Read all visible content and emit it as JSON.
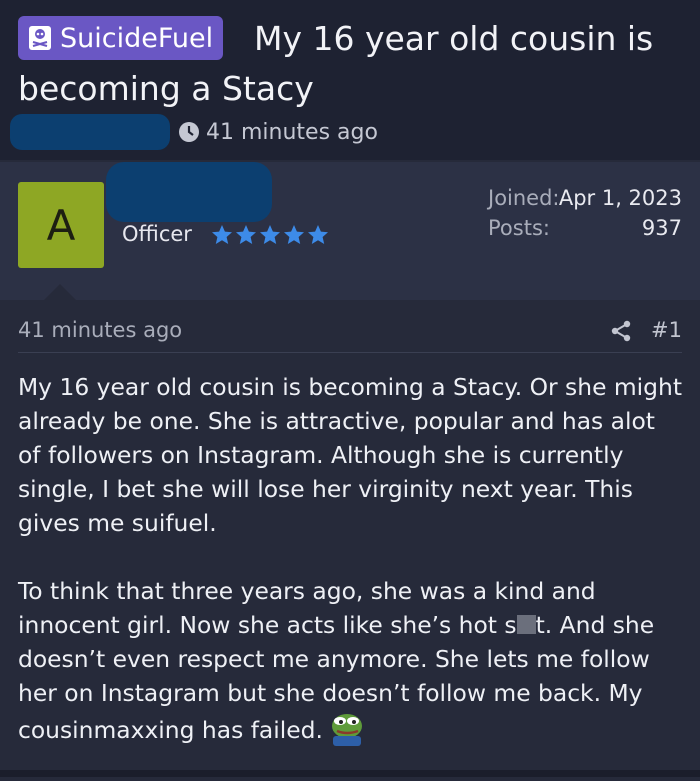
{
  "thread": {
    "prefix": "SuicideFuel",
    "title": "My 16 year old cousin is becoming a Stacy",
    "time": "41 minutes ago"
  },
  "author": {
    "avatar_letter": "A",
    "role": "Officer",
    "star_count": 5,
    "joined_label": "Joined:",
    "joined_value": "Apr 1, 2023",
    "posts_label": "Posts:",
    "posts_value": "937"
  },
  "post": {
    "time": "41 minutes ago",
    "number": "#1",
    "paragraph1": "My 16 year old cousin is becoming a Stacy. Or she might already be one. She is attractive, popular and has alot of followers on Instagram. Although she is currently single, I bet she will lose her virginity next year. This gives me suifuel.",
    "paragraph2_a": "To think that three years ago, she was a kind and innocent girl. Now she acts like she’s hot s",
    "paragraph2_b": "t. And she doesn’t even respect me anymore. She lets me follow her on Instagram but she doesn’t follow me back. My cousinmaxxing has failed."
  },
  "icons": [
    "skull-icon",
    "clock-icon",
    "star-icon",
    "share-icon",
    "pepe-emoji-icon"
  ],
  "colors": {
    "prefix_bg": "#6a57c4",
    "avatar_bg": "#8ea724",
    "star": "#3d8be8",
    "redaction": "#0c3f70"
  }
}
